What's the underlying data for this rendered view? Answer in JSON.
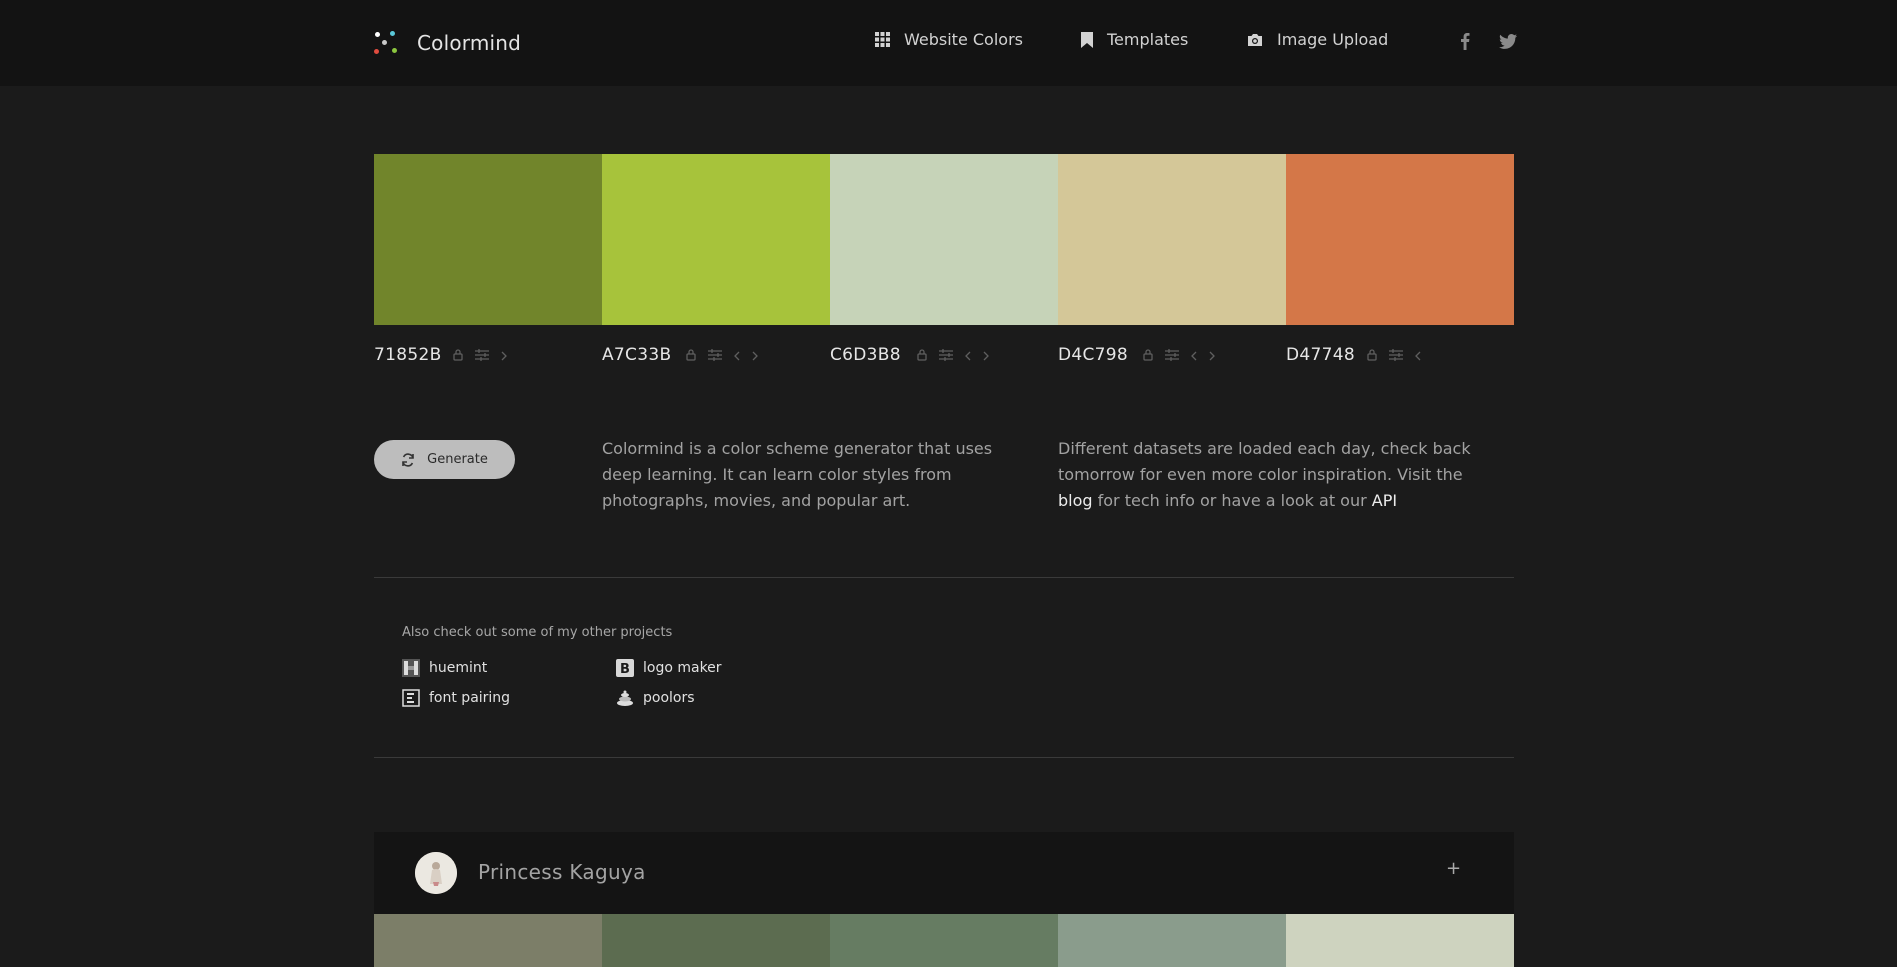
{
  "brand": {
    "name": "Colormind"
  },
  "nav": [
    {
      "label": "Website Colors",
      "icon": "grid-icon"
    },
    {
      "label": "Templates",
      "icon": "bookmark-icon"
    },
    {
      "label": "Image Upload",
      "icon": "camera-icon"
    }
  ],
  "social": [
    {
      "icon": "facebook-icon"
    },
    {
      "icon": "twitter-icon"
    }
  ],
  "palette": [
    {
      "hex": "71852B",
      "color": "#71852B"
    },
    {
      "hex": "A7C33B",
      "color": "#A7C33B"
    },
    {
      "hex": "C6D3B8",
      "color": "#C6D3B8"
    },
    {
      "hex": "D4C798",
      "color": "#D4C798"
    },
    {
      "hex": "D47748",
      "color": "#D47748"
    }
  ],
  "generate": {
    "label": "Generate"
  },
  "description_left": "Colormind is a color scheme generator that uses deep learning. It can learn color styles from photographs, movies, and popular art.",
  "description_right": {
    "text_1": "Different datasets are loaded each day, check back tomorrow for even more color inspiration. Visit the ",
    "blog_link": "blog",
    "text_2": " for tech info or have a look at our ",
    "api_link": "API"
  },
  "projects": {
    "title": "Also check out some of my other projects",
    "items": [
      {
        "label": "huemint",
        "icon": "huemint-icon"
      },
      {
        "label": "logo maker",
        "icon": "logo-maker-icon"
      },
      {
        "label": "font pairing",
        "icon": "font-pairing-icon"
      },
      {
        "label": "poolors",
        "icon": "poolors-icon"
      }
    ]
  },
  "featured": {
    "title": "Princess Kaguya",
    "expand_symbol": "+",
    "colors": [
      "#7C7E68",
      "#5C6C50",
      "#667C62",
      "#8A9C8C",
      "#CED3BF"
    ]
  }
}
